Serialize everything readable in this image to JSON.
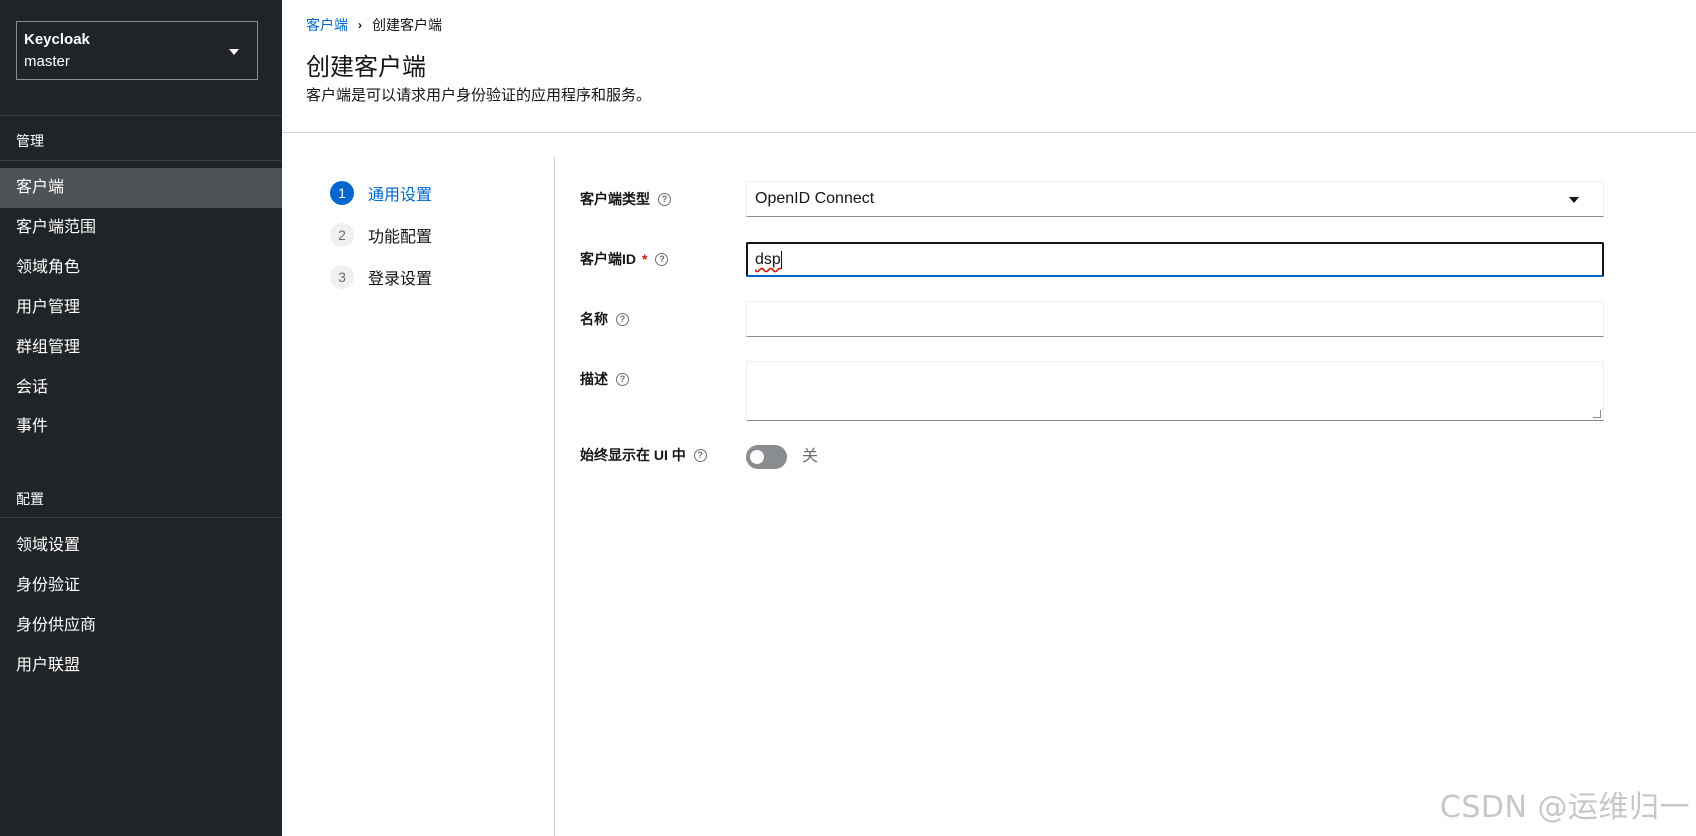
{
  "sidebar": {
    "realm_select": {
      "name": "Keycloak",
      "value": "master"
    },
    "section_manage": "管理",
    "manage_items": [
      {
        "label": "客户端",
        "active": true
      },
      {
        "label": "客户端范围"
      },
      {
        "label": "领域角色"
      },
      {
        "label": "用户管理"
      },
      {
        "label": "群组管理"
      },
      {
        "label": "会话"
      },
      {
        "label": "事件"
      }
    ],
    "section_configure": "配置",
    "configure_items": [
      {
        "label": "领域设置"
      },
      {
        "label": "身份验证"
      },
      {
        "label": "身份供应商"
      },
      {
        "label": "用户联盟"
      }
    ]
  },
  "breadcrumb": {
    "parent": "客户端",
    "current": "创建客户端"
  },
  "page": {
    "title": "创建客户端",
    "description": "客户端是可以请求用户身份验证的应用程序和服务。"
  },
  "wizard": {
    "steps": [
      {
        "number": "1",
        "label": "通用设置",
        "current": true
      },
      {
        "number": "2",
        "label": "功能配置"
      },
      {
        "number": "3",
        "label": "登录设置"
      }
    ]
  },
  "form": {
    "client_type": {
      "label": "客户端类型",
      "value": "OpenID Connect"
    },
    "client_id": {
      "label": "客户端ID",
      "required_mark": "*",
      "value": "dsp"
    },
    "name": {
      "label": "名称",
      "value": ""
    },
    "description": {
      "label": "描述",
      "value": ""
    },
    "always_display": {
      "label": "始终显示在 UI 中",
      "state_label": "关",
      "on": false
    }
  },
  "icons": {
    "help": "help-circle-icon",
    "caret": "caret-down-icon"
  },
  "colors": {
    "sidebar_bg": "#212427",
    "sidebar_active": "#4f5255",
    "link": "#0066cc",
    "required": "#c9190b"
  },
  "watermark": "CSDN @运维归一"
}
